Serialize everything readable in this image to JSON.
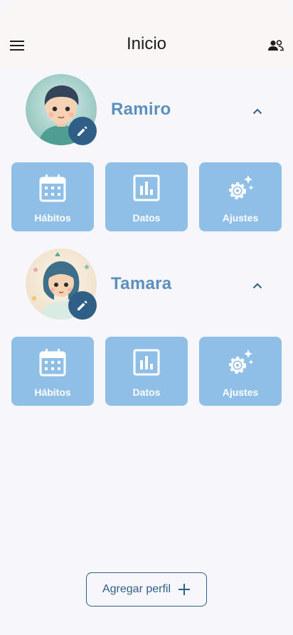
{
  "header": {
    "title": "Inicio"
  },
  "colors": {
    "topbar": "#fbf6f6",
    "accent_dark": "#2f5f86",
    "name_blue": "#5b8fbd",
    "tile_blue": "#8fbfe6"
  },
  "profiles": [
    {
      "name": "Ramiro",
      "tiles": [
        {
          "label": "Hábitos",
          "icon": "calendar-icon"
        },
        {
          "label": "Datos",
          "icon": "chart-icon"
        },
        {
          "label": "Ajustes",
          "icon": "gear-sparkle-icon"
        }
      ]
    },
    {
      "name": "Tamara",
      "tiles": [
        {
          "label": "Hábitos",
          "icon": "calendar-icon"
        },
        {
          "label": "Datos",
          "icon": "chart-icon"
        },
        {
          "label": "Ajustes",
          "icon": "gear-sparkle-icon"
        }
      ]
    }
  ],
  "footer": {
    "add_profile_label": "Agregar perfil"
  }
}
